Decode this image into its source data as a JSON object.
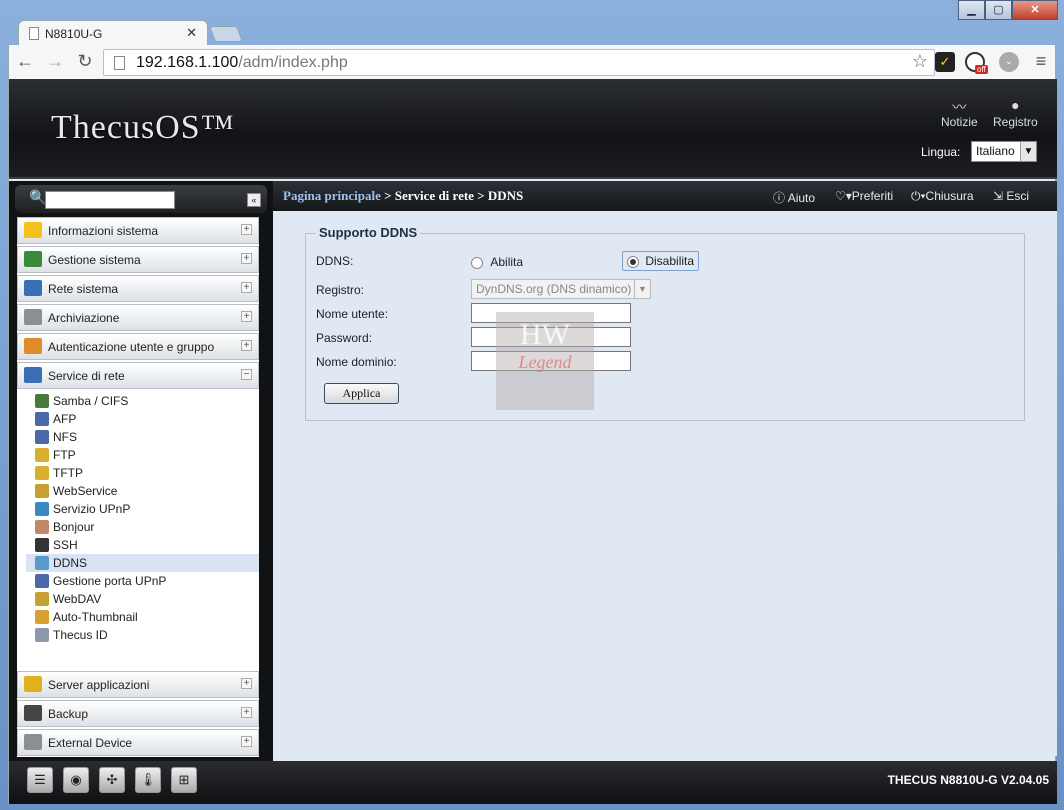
{
  "browser": {
    "tab_title": "N8810U-G",
    "url_host": "192.168.1.100",
    "url_path": "/adm/index.php",
    "ext_badge": "off"
  },
  "header": {
    "logo": "ThecusOS™",
    "news_label": "Notizie",
    "log_label": "Registro",
    "language_label": "Lingua:",
    "language_value": "Italiano"
  },
  "breadcrumb": {
    "home": "Pagina principale",
    "rest": " > Service di rete > DDNS"
  },
  "toolbar": {
    "help": "Aiuto",
    "favorites": "Preferiti",
    "shutdown": "Chiusura",
    "logout": "Esci"
  },
  "sidebar": {
    "sections_top": [
      {
        "label": "Informazioni sistema",
        "icon": "info-icon",
        "color": "#f2c21a"
      },
      {
        "label": "Gestione sistema",
        "icon": "tools-icon",
        "color": "#3b8a3b"
      },
      {
        "label": "Rete sistema",
        "icon": "network-icon",
        "color": "#3a6fb5"
      },
      {
        "label": "Archiviazione",
        "icon": "storage-icon",
        "color": "#8a8f96"
      },
      {
        "label": "Autenticazione utente e gruppo",
        "icon": "users-icon",
        "color": "#e08a2a"
      },
      {
        "label": "Service di rete",
        "icon": "network-service-icon",
        "color": "#3a6fb5"
      }
    ],
    "sub_items": [
      {
        "label": "Samba / CIFS",
        "icon": "samba-icon",
        "color": "#4a7a3a"
      },
      {
        "label": "AFP",
        "icon": "afp-icon",
        "color": "#4a6aa5"
      },
      {
        "label": "NFS",
        "icon": "nfs-icon",
        "color": "#4a6aa5"
      },
      {
        "label": "FTP",
        "icon": "ftp-icon",
        "color": "#d8b030"
      },
      {
        "label": "TFTP",
        "icon": "tftp-icon",
        "color": "#d8b030"
      },
      {
        "label": "WebService",
        "icon": "webservice-icon",
        "color": "#c8a030"
      },
      {
        "label": "Servizio UPnP",
        "icon": "upnp-icon",
        "color": "#3a8ac0"
      },
      {
        "label": "Bonjour",
        "icon": "bonjour-icon",
        "color": "#c08a6a"
      },
      {
        "label": "SSH",
        "icon": "ssh-icon",
        "color": "#333333"
      },
      {
        "label": "DDNS",
        "icon": "ddns-icon",
        "color": "#5a9ac8"
      },
      {
        "label": "Gestione porta UPnP",
        "icon": "upnp-port-icon",
        "color": "#4a6aa5"
      },
      {
        "label": "WebDAV",
        "icon": "webdav-icon",
        "color": "#c8a030"
      },
      {
        "label": "Auto-Thumbnail",
        "icon": "thumbnail-icon",
        "color": "#d8a030"
      },
      {
        "label": "Thecus ID",
        "icon": "thecus-id-icon",
        "color": "#8a9aaa"
      }
    ],
    "sections_bottom": [
      {
        "label": "Server applicazioni",
        "icon": "app-server-icon",
        "color": "#e0b020"
      },
      {
        "label": "Backup",
        "icon": "backup-icon",
        "color": "#444444"
      },
      {
        "label": "External Device",
        "icon": "external-device-icon",
        "color": "#8a8f96"
      }
    ]
  },
  "ddns": {
    "legend": "Supporto DDNS",
    "ddns_label": "DDNS:",
    "enable_label": "Abilita",
    "disable_label": "Disabilita",
    "selected": "Disabilita",
    "registry_label": "Registro:",
    "registry_value": "DynDNS.org (DNS dinamico)",
    "username_label": "Nome utente:",
    "username_value": "",
    "password_label": "Password:",
    "password_value": "",
    "domain_label": "Nome dominio:",
    "domain_value": "",
    "apply_button": "Applica"
  },
  "watermark": {
    "line1": "HW",
    "line2": "Legend"
  },
  "footer": {
    "firmware": "THECUS N8810U-G V2.04.05",
    "icons": [
      "server-icon",
      "disk-icon",
      "fan-icon",
      "thermometer-icon",
      "network-tree-icon"
    ]
  },
  "colors": {
    "accent": "#9ec3ea",
    "content_bg": "#dfe8f3",
    "header_bg": "#121316"
  }
}
